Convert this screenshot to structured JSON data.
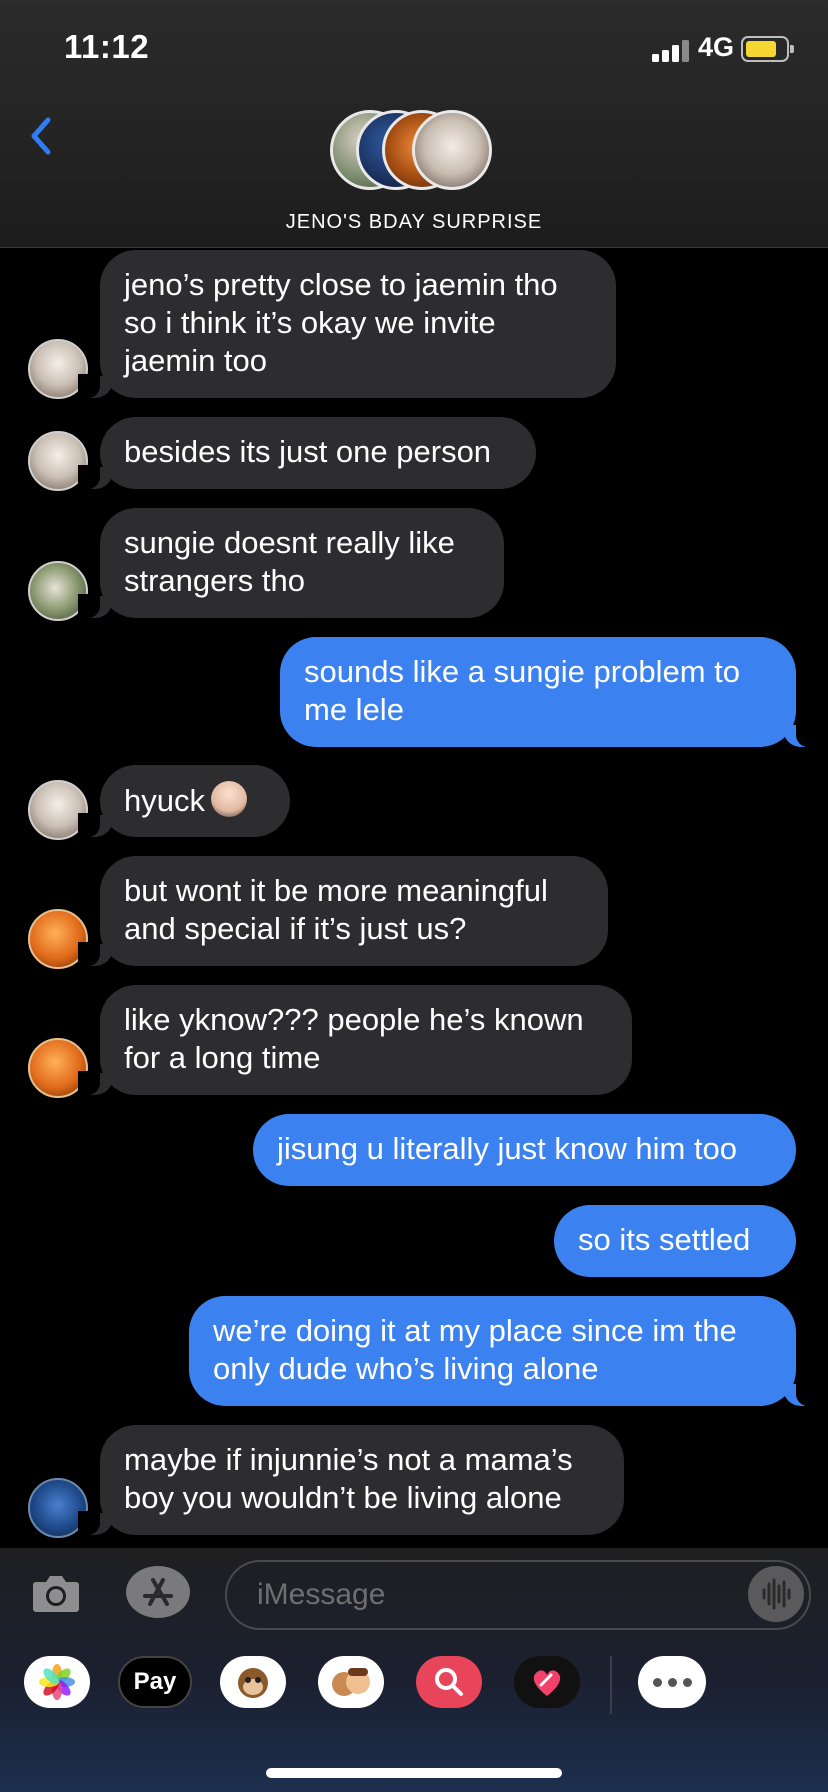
{
  "status_bar": {
    "time": "11:12",
    "network": "4G"
  },
  "header": {
    "group_name": "JENO'S BDAY SURPRISE",
    "back_icon": "chevron-left-icon",
    "accent_color": "#2f7df6"
  },
  "messages": [
    {
      "direction": "received",
      "text_lines": [
        "jeno’s pretty close to jaemin tho",
        "so i think it’s okay we invite",
        "jaemin too"
      ]
    },
    {
      "direction": "received",
      "text_lines": [
        "besides its just one person"
      ]
    },
    {
      "direction": "received",
      "text_lines": [
        "sungie doesnt really like",
        "strangers tho"
      ]
    },
    {
      "direction": "sent",
      "text_lines": [
        "sounds like a sungie problem to",
        "me lele"
      ]
    },
    {
      "direction": "received",
      "text_lines": [
        "hyuck"
      ],
      "emoji": "face-palm-emoji"
    },
    {
      "direction": "received",
      "text_lines": [
        "but wont it be more meaningful",
        "and special if it’s just us?"
      ]
    },
    {
      "direction": "received",
      "text_lines": [
        "like yknow??? people he’s known",
        "for a long time"
      ]
    },
    {
      "direction": "sent",
      "text_lines": [
        "jisung u literally just know him too"
      ]
    },
    {
      "direction": "sent",
      "text_lines": [
        "so its settled"
      ]
    },
    {
      "direction": "sent",
      "text_lines": [
        "we’re doing it at my place since im the",
        "only dude who’s living alone"
      ]
    },
    {
      "direction": "received",
      "text_lines": [
        "maybe if injunnie’s not a mama’s",
        "boy you wouldn’t be living alone"
      ]
    }
  ],
  "compose": {
    "placeholder": "iMessage",
    "camera_icon": "camera-icon",
    "apps_icon": "app-store-icon",
    "audio_icon": "audio-waveform-icon",
    "apps": [
      {
        "name": "photos-app-icon"
      },
      {
        "name": "apple-pay-app",
        "label": "Pay"
      },
      {
        "name": "animoji-app-icon"
      },
      {
        "name": "memoji-app-icon"
      },
      {
        "name": "image-search-app-icon"
      },
      {
        "name": "digital-touch-app-icon"
      },
      {
        "name": "more-apps-icon"
      }
    ]
  },
  "colors": {
    "sent_bubble": "#3b82f0",
    "received_bubble": "#2d2d2f",
    "battery": "#f6d631"
  }
}
